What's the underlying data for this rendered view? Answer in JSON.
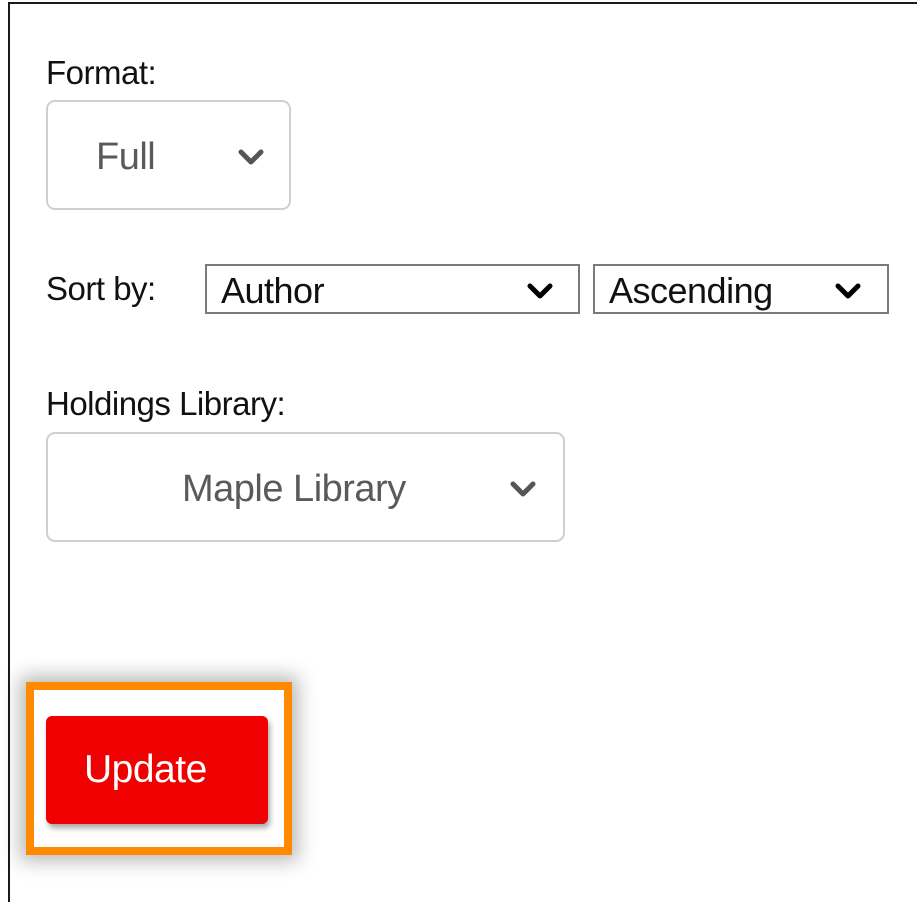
{
  "format": {
    "label": "Format:",
    "selected": "Full"
  },
  "sort": {
    "label": "Sort by:",
    "field_selected": "Author",
    "order_selected": "Ascending"
  },
  "holdings": {
    "label": "Holdings Library:",
    "selected": "Maple Library"
  },
  "actions": {
    "update_label": "Update"
  },
  "colors": {
    "update_button": "#f00000",
    "highlight_border": "#ff8a00"
  },
  "icons": {
    "dropdown": "chevron-down-icon"
  }
}
